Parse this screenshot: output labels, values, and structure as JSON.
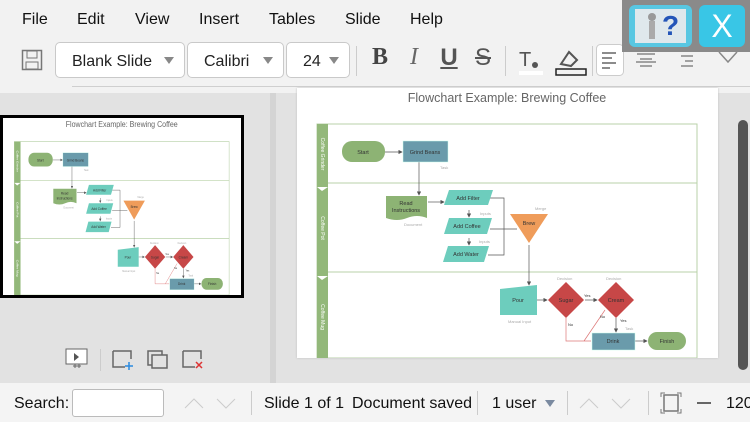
{
  "menu": [
    "File",
    "Edit",
    "View",
    "Insert",
    "Tables",
    "Slide",
    "Help"
  ],
  "toolbar": {
    "layout": "Blank Slide",
    "font": "Calibri",
    "size": "24",
    "bold": "B",
    "italic": "I",
    "underline": "U",
    "strike": "S"
  },
  "help": {
    "help_icon": "?",
    "close_icon": "X"
  },
  "slide": {
    "title": "Flowchart Example: Brewing Coffee",
    "lanes": [
      "Coffee Grinder",
      "Coffee Pot",
      "Coffee Mug"
    ],
    "shapes": {
      "start": "Start",
      "grind": "Grind Beans",
      "read1": "Read",
      "read2": "Instructions",
      "filter": "Add Filter",
      "coffee": "Add Coffee",
      "water": "Add Water",
      "brew": "Brew",
      "pour": "Pour",
      "sugar": "Sugar",
      "cream": "Cream",
      "drink": "Drink",
      "finish": "Finish"
    },
    "notes": {
      "task": "Task",
      "document": "Document",
      "inputs": "Inputs",
      "merge": "Merge",
      "decision": "Decision",
      "manual": "Manual Input",
      "yes": "Yes",
      "no": "No"
    }
  },
  "status": {
    "search_label": "Search:",
    "search_value": "",
    "slide": "Slide 1 of 1",
    "saved": "Document saved",
    "users": "1 user",
    "zoom": "120"
  },
  "colors": {
    "accent": "#39c6e6",
    "lane": "#93b87a",
    "task": "#6a9bab",
    "start": "#8db374",
    "io": "#6dcdbd",
    "merge": "#ef9c5a",
    "decision": "#c74747"
  }
}
